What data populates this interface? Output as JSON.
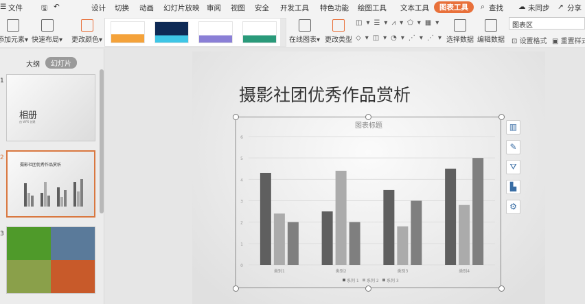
{
  "menu": {
    "file": "文件",
    "tabs": [
      "设计",
      "切换",
      "动画",
      "幻灯片放映",
      "审阅",
      "视图",
      "安全",
      "开发工具",
      "特色功能",
      "绘图工具",
      "文本工具",
      "图表工具"
    ],
    "search": "查找",
    "sync": "未同步",
    "share": "分享"
  },
  "ribbon": {
    "add_element": "添加元素",
    "quick_layout": "快速布局",
    "change_color": "更改颜色",
    "online_chart": "在线图表",
    "change_type": "更改类型",
    "select_data": "选择数据",
    "edit_data": "编辑数据",
    "chart_area": "图表区",
    "set_format": "设置格式",
    "reset_style": "重置样式"
  },
  "side": {
    "outline_tab": "大纲",
    "slides_tab": "幻灯片",
    "slides": [
      {
        "num": "1",
        "title": "相册",
        "subtitle": "由 WPS 创建"
      },
      {
        "num": "2",
        "title": "摄影社团优秀作品赏析"
      },
      {
        "num": "3"
      }
    ]
  },
  "slide": {
    "title": "摄影社团优秀作品赏析"
  },
  "chart_data": {
    "type": "bar",
    "title": "图表标题",
    "categories": [
      "类别1",
      "类别2",
      "类别3",
      "类别4"
    ],
    "series": [
      {
        "name": "系列 1",
        "values": [
          4.3,
          2.5,
          3.5,
          4.5
        ],
        "color": "#5f5f5f"
      },
      {
        "name": "系列 2",
        "values": [
          2.4,
          4.4,
          1.8,
          2.8
        ],
        "color": "#ababab"
      },
      {
        "name": "系列 3",
        "values": [
          2,
          2,
          3,
          5
        ],
        "color": "#7f7f7f"
      }
    ],
    "ylim": [
      0,
      6
    ],
    "yticks": [
      0,
      1,
      2,
      3,
      4,
      5,
      6
    ],
    "grid": true,
    "legend": "bottom"
  }
}
